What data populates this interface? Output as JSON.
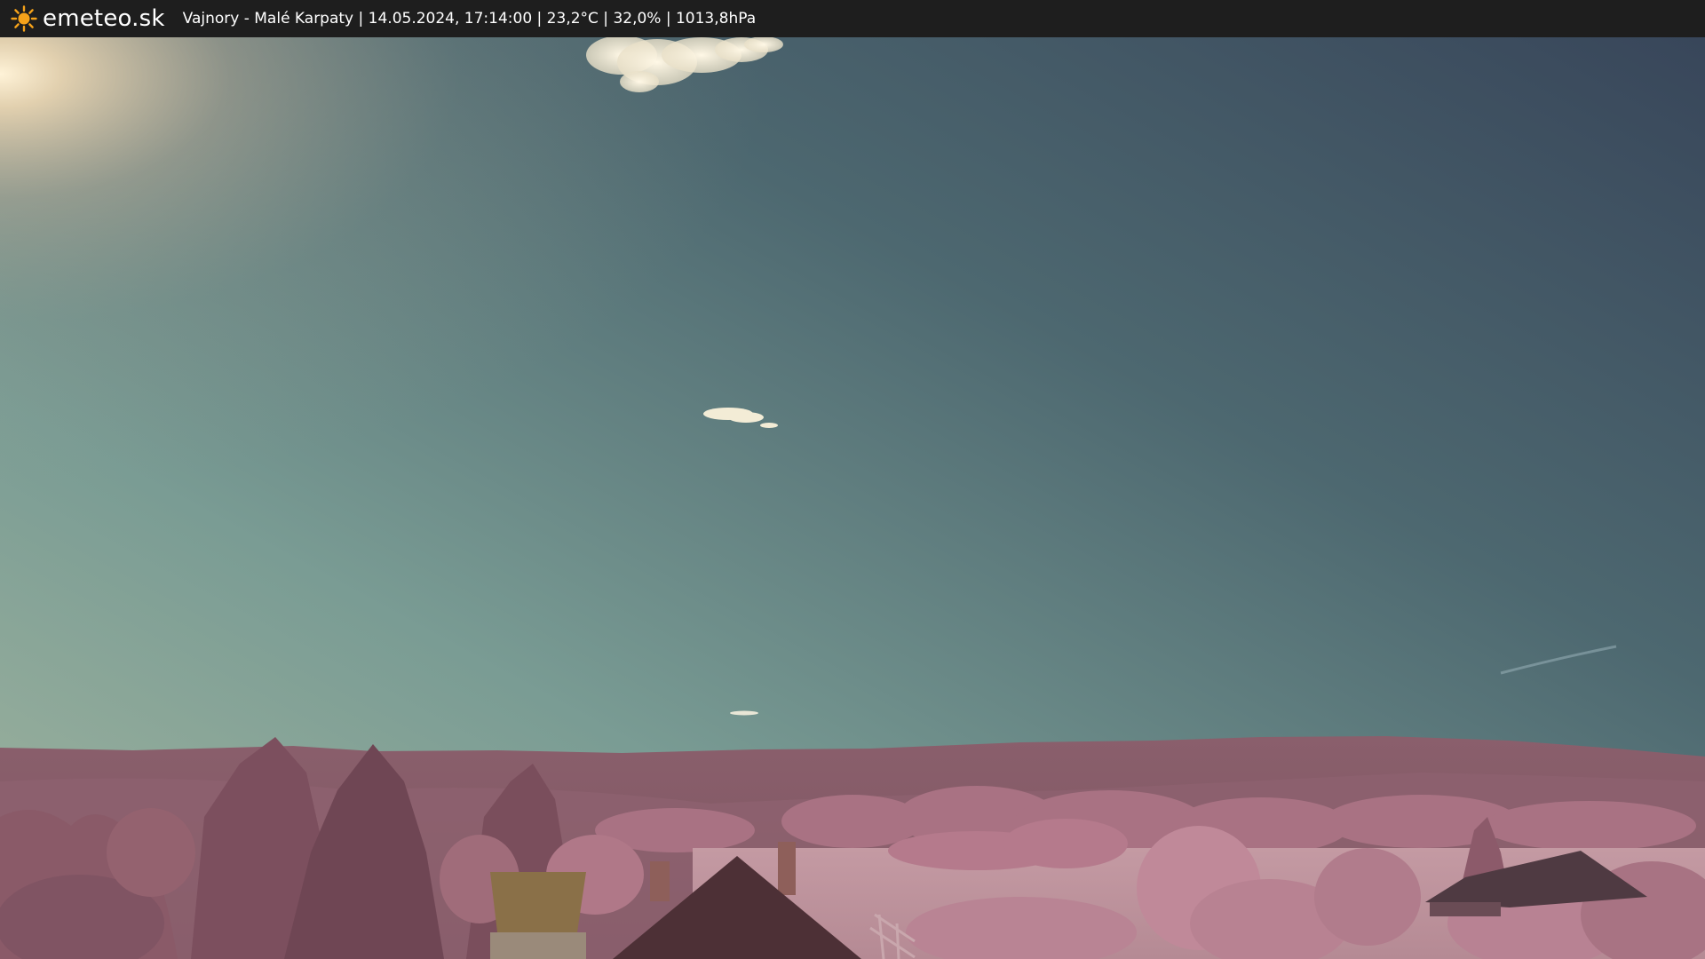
{
  "header": {
    "brand": "emeteo.sk",
    "brand_icon": "sun-icon",
    "caption": "Vajnory - Malé Karpaty | 14.05.2024, 17:14:00 | 23,2°C | 32,0% | 1013,8hPa"
  },
  "colors": {
    "bar_background": "#1e1e1e",
    "sun_icon": "#f5a21a",
    "sky_top": "#3a4d58",
    "sky_horizon": "#8fb0a0",
    "hills": "#8a5f6a",
    "foliage": "#b07a8c"
  }
}
